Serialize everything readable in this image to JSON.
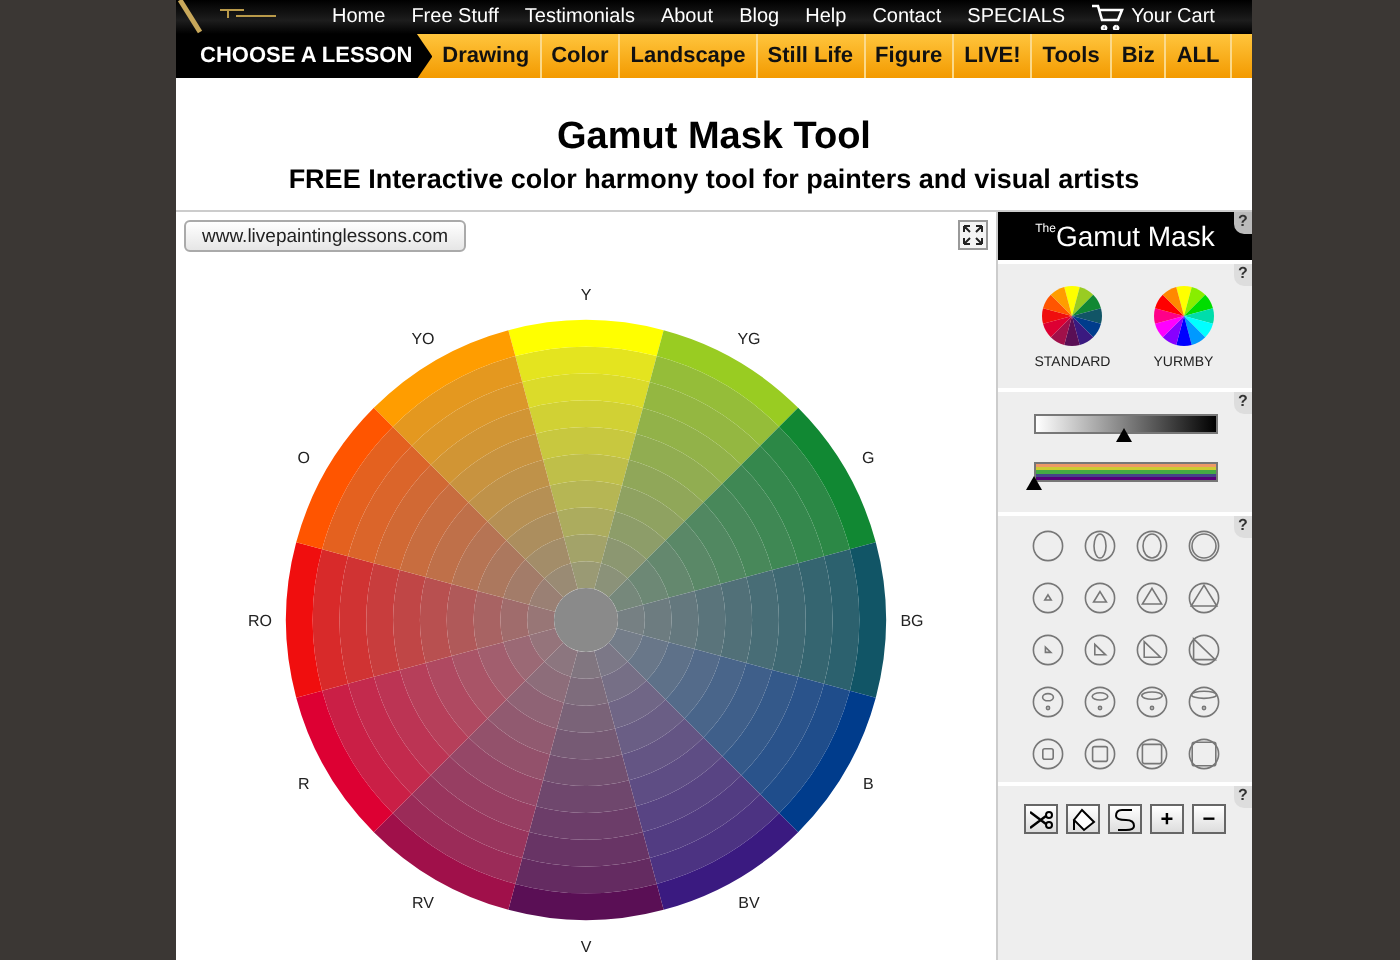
{
  "top_nav": [
    "Home",
    "Free Stuff",
    "Testimonials",
    "About",
    "Blog",
    "Help",
    "Contact",
    "SPECIALS",
    "Your Cart"
  ],
  "lesson_bar": {
    "label": "CHOOSE A LESSON",
    "items": [
      "Drawing",
      "Color",
      "Landscape",
      "Still Life",
      "Figure",
      "LIVE!",
      "Tools",
      "Biz",
      "ALL"
    ]
  },
  "header": {
    "title": "Gamut Mask Tool",
    "subtitle": "FREE Interactive color harmony tool for painters and visual artists"
  },
  "canvas": {
    "url_button": "www.livepaintinglessons.com",
    "hues": [
      {
        "label": "Y",
        "color": "#ffff00"
      },
      {
        "label": "YG",
        "color": "#99cc22"
      },
      {
        "label": "G",
        "color": "#118833"
      },
      {
        "label": "BG",
        "color": "#115566"
      },
      {
        "label": "B",
        "color": "#003c8c"
      },
      {
        "label": "BV",
        "color": "#3a1a80"
      },
      {
        "label": "V",
        "color": "#5a0f55"
      },
      {
        "label": "RV",
        "color": "#a0104a"
      },
      {
        "label": "R",
        "color": "#dd0033"
      },
      {
        "label": "RO",
        "color": "#f00e0e"
      },
      {
        "label": "O",
        "color": "#ff5500"
      },
      {
        "label": "YO",
        "color": "#ff9d00"
      }
    ]
  },
  "panel": {
    "title_sup": "The",
    "title": "Gamut Mask",
    "help": [
      "?",
      "?",
      "?",
      "?",
      "?"
    ],
    "wheels": [
      "STANDARD",
      "YURMBY"
    ],
    "value_slider": {
      "level": 0.5
    },
    "saturation_slider": {
      "level": 0.0
    },
    "tools": [
      {
        "kind": "scissors"
      },
      {
        "kind": "bucket"
      },
      {
        "kind": "curve"
      },
      {
        "kind": "text",
        "label": "+"
      },
      {
        "kind": "text",
        "label": "−"
      }
    ]
  }
}
